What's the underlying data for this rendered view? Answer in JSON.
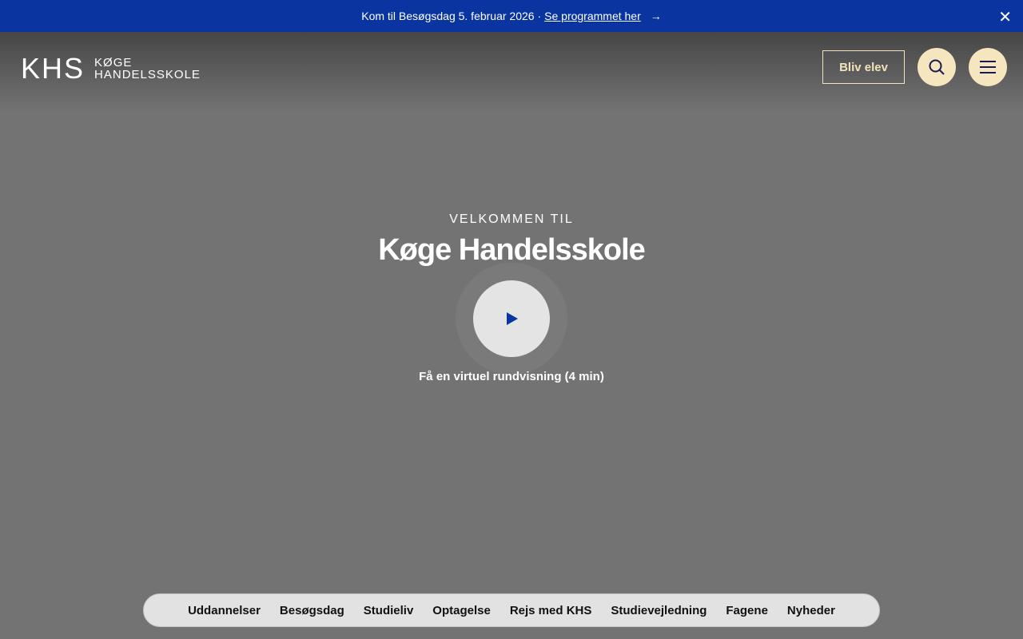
{
  "banner": {
    "text": "Kom til Besøgsdag 5. februar 2026 ·",
    "link": "Se programmet her",
    "arrow": "→",
    "close": "✕"
  },
  "logo": {
    "big": "KHS",
    "line1": "KØGE",
    "line2": "HANDELSSKOLE"
  },
  "header": {
    "cta": "Bliv elev"
  },
  "hero": {
    "kicker": "VELKOMMEN TIL",
    "title": "Køge Handelsskole",
    "caption": "Få en virtuel rundvisning (4 min)"
  },
  "nav": [
    "Uddannelser",
    "Besøgsdag",
    "Studieliv",
    "Optagelse",
    "Rejs med KHS",
    "Studievejledning",
    "Fagene",
    "Nyheder"
  ],
  "colors": {
    "banner": "#0a35a0",
    "accent": "#f5e6c0"
  }
}
